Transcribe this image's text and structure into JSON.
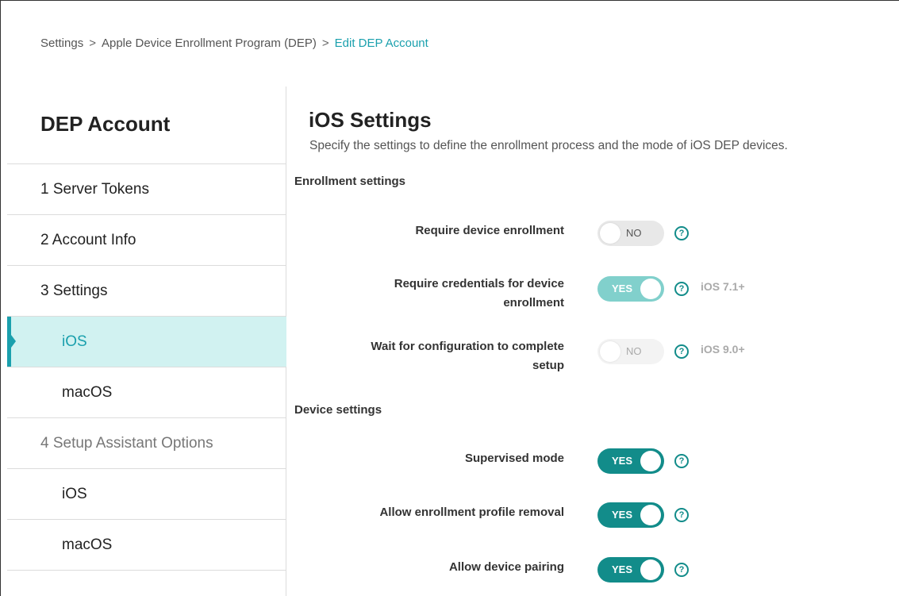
{
  "breadcrumb": {
    "items": [
      "Settings",
      "Apple Device Enrollment Program (DEP)"
    ],
    "separator": ">",
    "current": "Edit DEP Account"
  },
  "sidebar": {
    "title": "DEP Account",
    "items": [
      {
        "label": "1  Server Tokens"
      },
      {
        "label": "2  Account Info"
      },
      {
        "label": "3  Settings"
      },
      {
        "label": "iOS",
        "active": true
      },
      {
        "label": "macOS"
      },
      {
        "label": "4  Setup Assistant Options"
      },
      {
        "label": "iOS"
      },
      {
        "label": "macOS"
      }
    ]
  },
  "main": {
    "title": "iOS Settings",
    "description": "Specify the settings to define the enrollment process and the mode of iOS DEP devices.",
    "enrollment_section": "Enrollment settings",
    "device_section": "Device settings",
    "help_icon_glyph": "?",
    "settings": [
      {
        "label": "Require device enrollment",
        "toggle": "NO",
        "state": "off"
      },
      {
        "label_line1": "Require credentials for device",
        "label_line2": "enrollment",
        "toggle": "YES",
        "state": "on",
        "version": "iOS 7.1+"
      },
      {
        "label_line1": "Wait for configuration to complete",
        "label_line2": "setup",
        "toggle": "NO",
        "state": "off-disabled",
        "version": "iOS 9.0+"
      },
      {
        "label": "Supervised mode",
        "toggle": "YES",
        "state": "on"
      },
      {
        "label": "Allow enrollment profile removal",
        "toggle": "YES",
        "state": "on"
      },
      {
        "label": "Allow device pairing",
        "toggle": "YES",
        "state": "on"
      }
    ]
  },
  "colors": {
    "accent": "#1aa0ad",
    "toggle_on": "#128c8a",
    "toggle_on_light": "#81d0cc",
    "active_nav_bg": "#d1f2f1"
  }
}
